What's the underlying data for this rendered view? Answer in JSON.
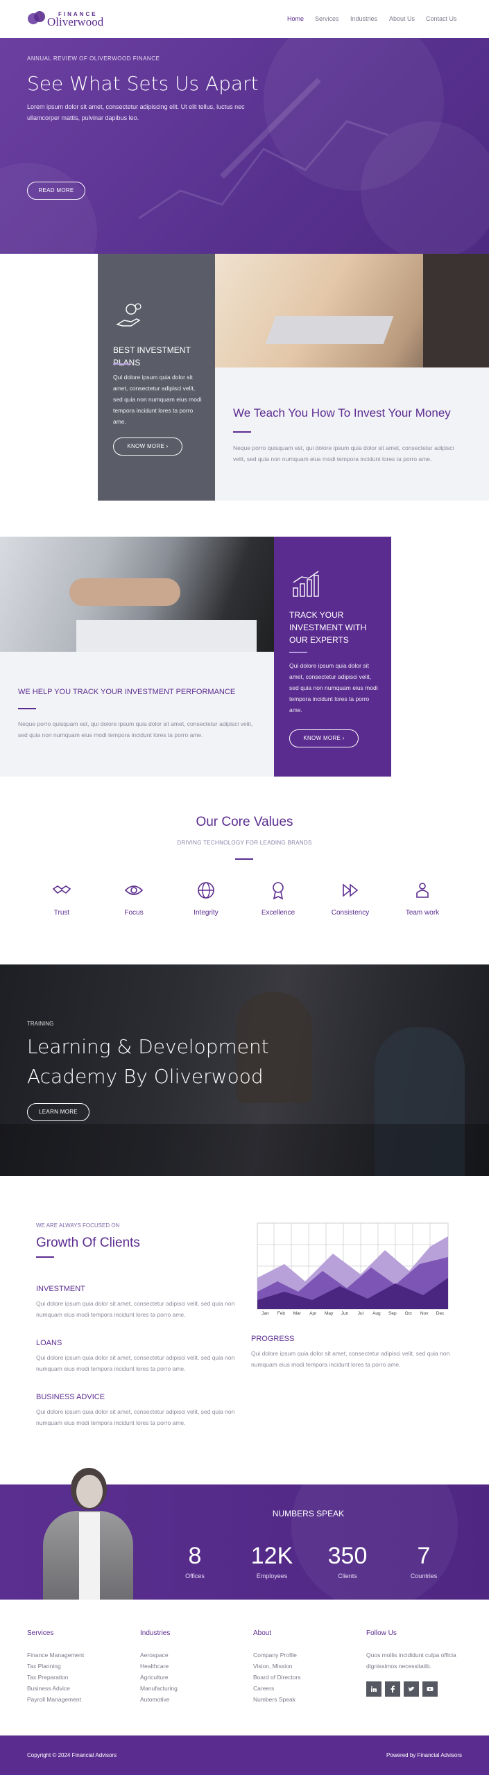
{
  "brand": {
    "tagline": "FINANCE",
    "name": "Oliverwood"
  },
  "nav": {
    "items": [
      {
        "label": "Home"
      },
      {
        "label": "Services"
      },
      {
        "label": "Industries"
      },
      {
        "label": "About Us"
      },
      {
        "label": "Contact Us"
      }
    ]
  },
  "hero": {
    "kicker": "ANNUAL REVIEW OF OLIVERWOOD FINANCE",
    "title": "See What Sets Us Apart",
    "text": "Lorem ipsum dolor sit amet, consectetur adipiscing elit. Ut elit tellus, luctus nec ullamcorper mattis, pulvinar dapibus leo.",
    "button": "READ MORE"
  },
  "plans": {
    "card_title": "BEST INVESTMENT PLANS",
    "card_text": "Qui dolore ipsum quia dolor sit amet, consectetur adipisci velit, sed quia non numquam eius modi tempora incidunt lores ta porro ame.",
    "card_button": "KNOW MORE",
    "title": "We Teach You How To Invest Your Money",
    "text": "Neque porro quisquam est, qui dolore ipsum quia dolor sit amet, consectetur adipisci velit, sed quia non numquam eius modi tempora incidunt lores ta porro ame."
  },
  "track": {
    "title": "WE HELP YOU TRACK YOUR INVESTMENT PERFORMANCE",
    "text": "Neque porro quisquam est, qui dolore ipsum quia dolor sit amet, consectetur adipisci velit, sed quia non numquam eius modi tempora incidunt lores ta porro ame.",
    "card_title": "TRACK YOUR INVESTMENT WITH OUR EXPERTS",
    "card_text": "Qui dolore ipsum quia dolor sit amet, consectetur adipisci velit, sed quia non numquam eius modi tempora incidunt lores ta porro ame.",
    "card_button": "KNOW MORE"
  },
  "values": {
    "title": "Our Core Values",
    "subtitle": "DRIVING TECHNOLOGY FOR LEADING BRANDS",
    "items": [
      {
        "label": "Trust",
        "icon": "handshake-icon"
      },
      {
        "label": "Focus",
        "icon": "eye-icon"
      },
      {
        "label": "Integrity",
        "icon": "globe-icon"
      },
      {
        "label": "Excellence",
        "icon": "award-icon"
      },
      {
        "label": "Consistency",
        "icon": "forward-icon"
      },
      {
        "label": "Team work",
        "icon": "team-icon"
      }
    ]
  },
  "academy": {
    "kicker": "TRAINING",
    "title": "Learning & Development Academy By Oliverwood",
    "button": "LEARN MORE"
  },
  "growth": {
    "kicker": "WE ARE ALWAYS FOCUSED ON",
    "title": "Growth Of Clients",
    "items": [
      {
        "heading": "INVESTMENT",
        "text": "Qui dolore ipsum quia dolor sit amet, consectetur adipisci velit, sed quia non numquam eius modi tempora incidunt lores ta porro ame."
      },
      {
        "heading": "LOANS",
        "text": "Qui dolore ipsum quia dolor sit amet, consectetur adipisci velit, sed quia non numquam eius modi tempora incidunt lores ta porro ame."
      },
      {
        "heading": "BUSINESS ADVICE",
        "text": "Qui dolore ipsum quia dolor sit amet, consectetur adipisci velit, sed quia non numquam eius modi tempora incidunt lores ta porro ame."
      }
    ],
    "progress_heading": "PROGRESS",
    "progress_text": "Qui dolore ipsum quia dolor sit amet, consectetur adipisci velit, sed quia non numquam eius modi tempora incidunt lores ta porro ame.",
    "chart_months": [
      "Jan",
      "Feb",
      "Mar",
      "Apr",
      "May",
      "Jun",
      "Jul",
      "Aug",
      "Sep",
      "Oct",
      "Nov",
      "Dec"
    ]
  },
  "numbers": {
    "title": "NUMBERS SPEAK",
    "items": [
      {
        "value": "8",
        "label": "Offices"
      },
      {
        "value": "12K",
        "label": "Employees"
      },
      {
        "value": "350",
        "label": "Clients"
      },
      {
        "value": "7",
        "label": "Countries"
      }
    ]
  },
  "footer": {
    "services": {
      "title": "Services",
      "links": [
        "Finance Management",
        "Tax Planning",
        "Tax Preparation",
        "Business Advice",
        "Payroll Management"
      ]
    },
    "industries": {
      "title": "Industries",
      "links": [
        "Aerospace",
        "Healthcare",
        "Agriculture",
        "Manufacturing",
        "Automotive"
      ]
    },
    "about": {
      "title": "About",
      "links": [
        "Company Profile",
        "Vision, Mission",
        "Board of Directors",
        "Careers",
        "Numbers Speak"
      ]
    },
    "follow": {
      "title": "Follow Us",
      "text": "Quos mollis incididunt culpa officia dignissimos necessitatib."
    },
    "copyright": "Copyright © 2024 Financial Advisors",
    "powered": "Powered by Financial Advisors"
  },
  "colors": {
    "brand": "#5b2c8f",
    "card_gray": "#5a5d68",
    "panel": "#f2f3f7"
  }
}
